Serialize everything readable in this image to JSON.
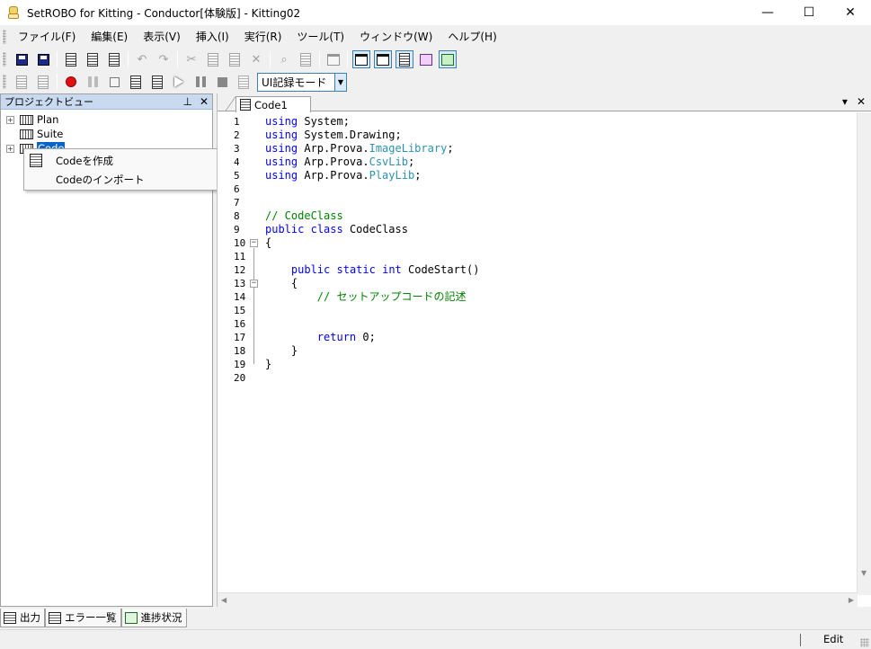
{
  "window": {
    "title": "SetROBO for Kitting - Conductor[体験版] - Kitting02",
    "controls": {
      "minimize": "—",
      "maximize": "☐",
      "close": "✕"
    }
  },
  "menubar": {
    "items": [
      "ファイル(F)",
      "編集(E)",
      "表示(V)",
      "挿入(I)",
      "実行(R)",
      "ツール(T)",
      "ウィンドウ(W)",
      "ヘルプ(H)"
    ]
  },
  "toolbar": {
    "icons": {
      "save": "save-icon",
      "save_all": "save-all-icon",
      "undo": "↶",
      "redo": "↷",
      "cut": "✂",
      "delete": "✕",
      "find": "⌕"
    },
    "mode_select": {
      "value": "UI記録モード"
    }
  },
  "project_panel": {
    "title": "プロジェクトビュー",
    "pin": "ᵖ",
    "close": "✕",
    "tree": [
      {
        "label": "Plan"
      },
      {
        "label": "Suite"
      },
      {
        "label": "Code"
      }
    ]
  },
  "context_menu": {
    "items": [
      {
        "label": "Codeを作成"
      },
      {
        "label": "Codeのインポート"
      }
    ]
  },
  "editor": {
    "tab": {
      "label": "Code1"
    },
    "tab_menu": "▾",
    "tab_close": "✕",
    "lines": [
      {
        "n": "1",
        "parts": [
          [
            "kw",
            "using"
          ],
          [
            "t",
            " System;"
          ]
        ]
      },
      {
        "n": "2",
        "parts": [
          [
            "kw",
            "using"
          ],
          [
            "t",
            " System.Drawing;"
          ]
        ]
      },
      {
        "n": "3",
        "parts": [
          [
            "kw",
            "using"
          ],
          [
            "t",
            " Arp.Prova."
          ],
          [
            "ns",
            "ImageLibrary"
          ],
          [
            "t",
            ";"
          ]
        ]
      },
      {
        "n": "4",
        "parts": [
          [
            "kw",
            "using"
          ],
          [
            "t",
            " Arp.Prova."
          ],
          [
            "ns",
            "CsvLib"
          ],
          [
            "t",
            ";"
          ]
        ]
      },
      {
        "n": "5",
        "parts": [
          [
            "kw",
            "using"
          ],
          [
            "t",
            " Arp.Prova."
          ],
          [
            "ns",
            "PlayLib"
          ],
          [
            "t",
            ";"
          ]
        ]
      },
      {
        "n": "6",
        "parts": []
      },
      {
        "n": "7",
        "parts": []
      },
      {
        "n": "8",
        "parts": [
          [
            "cm",
            "// CodeClass"
          ]
        ]
      },
      {
        "n": "9",
        "parts": [
          [
            "kw",
            "public"
          ],
          [
            "t",
            " "
          ],
          [
            "kw",
            "class"
          ],
          [
            "t",
            " CodeClass"
          ]
        ]
      },
      {
        "n": "10",
        "parts": [
          [
            "t",
            "{"
          ]
        ]
      },
      {
        "n": "11",
        "parts": []
      },
      {
        "n": "12",
        "parts": [
          [
            "t",
            "    "
          ],
          [
            "kw",
            "public"
          ],
          [
            "t",
            " "
          ],
          [
            "kw",
            "static"
          ],
          [
            "t",
            " "
          ],
          [
            "kw",
            "int"
          ],
          [
            "t",
            " CodeStart()"
          ]
        ]
      },
      {
        "n": "13",
        "parts": [
          [
            "t",
            "    {"
          ]
        ]
      },
      {
        "n": "14",
        "parts": [
          [
            "t",
            "        "
          ],
          [
            "cm",
            "// セットアップコードの記述"
          ]
        ]
      },
      {
        "n": "15",
        "parts": []
      },
      {
        "n": "16",
        "parts": []
      },
      {
        "n": "17",
        "parts": [
          [
            "t",
            "        "
          ],
          [
            "kw",
            "return"
          ],
          [
            "t",
            " 0;"
          ]
        ]
      },
      {
        "n": "18",
        "parts": [
          [
            "t",
            "    }"
          ]
        ]
      },
      {
        "n": "19",
        "parts": [
          [
            "t",
            "}"
          ]
        ]
      },
      {
        "n": "20",
        "parts": []
      }
    ]
  },
  "bottom_tabs": [
    {
      "label": "出力"
    },
    {
      "label": "エラー一覧"
    },
    {
      "label": "進捗状況"
    }
  ],
  "status": {
    "mode": "Edit"
  },
  "colors": {
    "keyword": "#0000ff",
    "comment": "#008000",
    "type": "#2b91af",
    "selection": "#0a64c8",
    "panel_header": "#c9daf0"
  }
}
